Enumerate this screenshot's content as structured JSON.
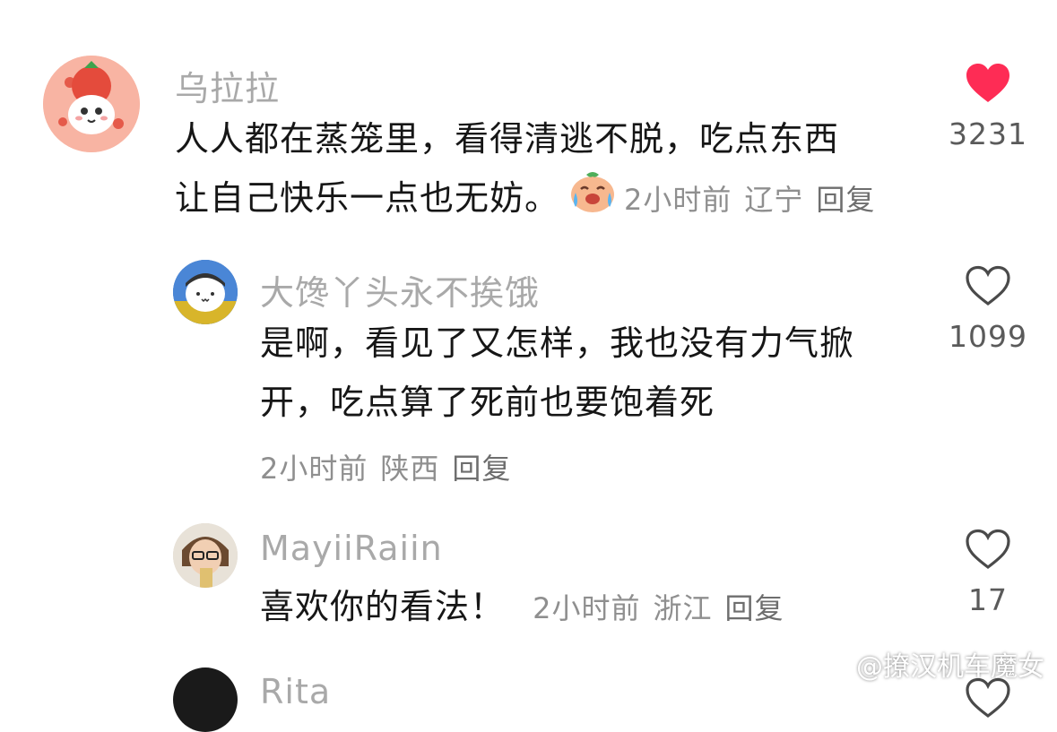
{
  "comments": [
    {
      "username": "乌拉拉",
      "text_line1": "人人都在蒸笼里，看得清逃不脱，吃点东西",
      "text_line2": "让自己快乐一点也无妨。",
      "emoji": "crying-laughing-peach-emoji",
      "time": "2小时前",
      "location": "辽宁",
      "reply_label": "回复",
      "like_count": "3231",
      "liked": true
    },
    {
      "username": "大馋丫头永不挨饿",
      "text_line1": "是啊，看见了又怎样，我也没有力气掀",
      "text_line2": "开，吃点算了死前也要饱着死",
      "time": "2小时前",
      "location": "陕西",
      "reply_label": "回复",
      "like_count": "1099",
      "liked": false
    },
    {
      "username": "MayiiRaiin",
      "text_line1": "喜欢你的看法！",
      "time": "2小时前",
      "location": "浙江",
      "reply_label": "回复",
      "like_count": "17",
      "liked": false
    },
    {
      "username": "Rita"
    }
  ],
  "watermark": "@撩汉机车魔女",
  "colors": {
    "liked_heart": "#fe2c55",
    "username": "#a9a9a9",
    "meta": "#8f8f8f"
  },
  "icons": {
    "like_filled": "heart-filled-icon",
    "like_outline": "heart-outline-icon",
    "watermark_logo": "weibo-logo-icon"
  }
}
